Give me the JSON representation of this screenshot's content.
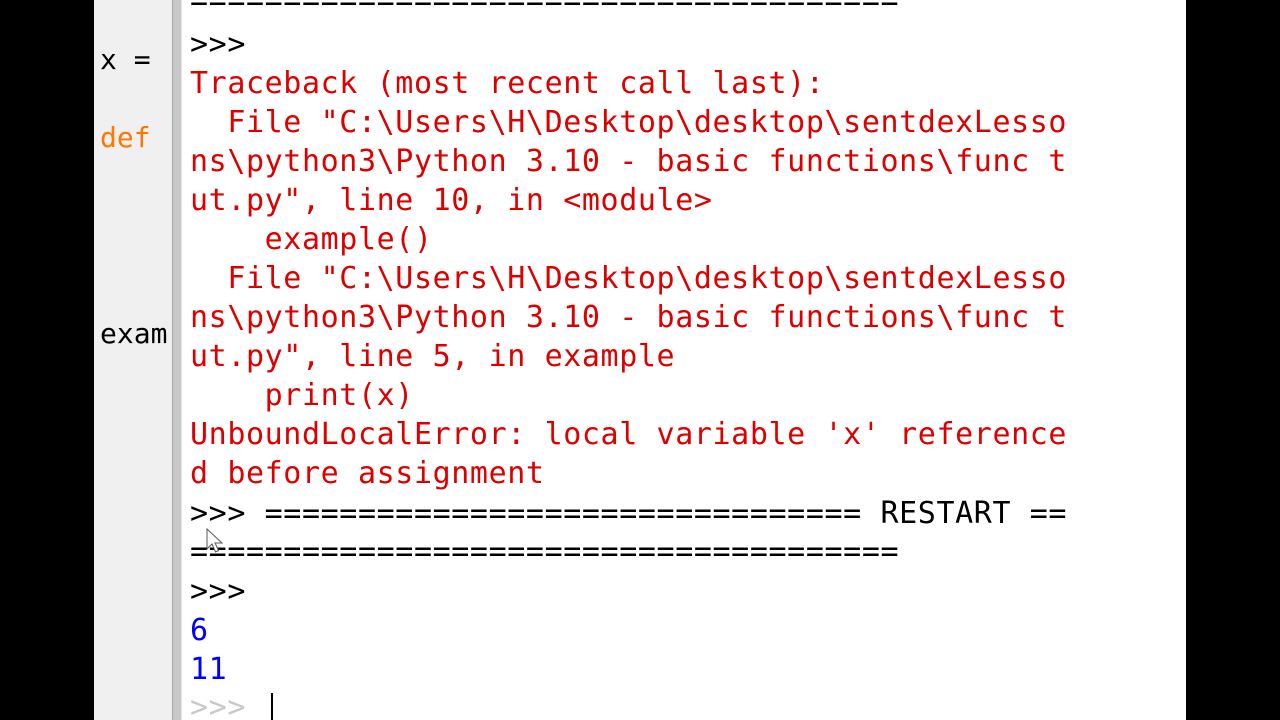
{
  "editor": {
    "lines": [
      {
        "text": "x =",
        "kind": "code"
      },
      {
        "text": "def",
        "kind": "keyword"
      },
      {
        "text": "exam",
        "kind": "code"
      }
    ]
  },
  "shell": {
    "lines": [
      {
        "text": "======================================",
        "color": "black"
      },
      {
        "text": ">>>",
        "color": "black"
      },
      {
        "text": "Traceback (most recent call last):",
        "color": "red"
      },
      {
        "text": "  File \"C:\\Users\\H\\Desktop\\desktop\\sentdexLesso",
        "color": "red"
      },
      {
        "text": "ns\\python3\\Python 3.10 - basic functions\\func t",
        "color": "red"
      },
      {
        "text": "ut.py\", line 10, in <module>",
        "color": "red"
      },
      {
        "text": "    example()",
        "color": "red"
      },
      {
        "text": "  File \"C:\\Users\\H\\Desktop\\desktop\\sentdexLesso",
        "color": "red"
      },
      {
        "text": "ns\\python3\\Python 3.10 - basic functions\\func t",
        "color": "red"
      },
      {
        "text": "ut.py\", line 5, in example",
        "color": "red"
      },
      {
        "text": "    print(x)",
        "color": "red"
      },
      {
        "text": "UnboundLocalError: local variable 'x' reference",
        "color": "red"
      },
      {
        "text": "d before assignment",
        "color": "red"
      },
      {
        "text": ">>> ================================ RESTART ==",
        "color": "black"
      },
      {
        "text": "======================================",
        "color": "black"
      },
      {
        "text": ">>>",
        "color": "black"
      },
      {
        "text": "6",
        "color": "blue"
      },
      {
        "text": "11",
        "color": "blue"
      }
    ],
    "prompt": ">>> "
  },
  "colors": {
    "error": "#dd0000",
    "output": "#0000ff",
    "keyword": "#ff7700",
    "text": "#000000"
  }
}
